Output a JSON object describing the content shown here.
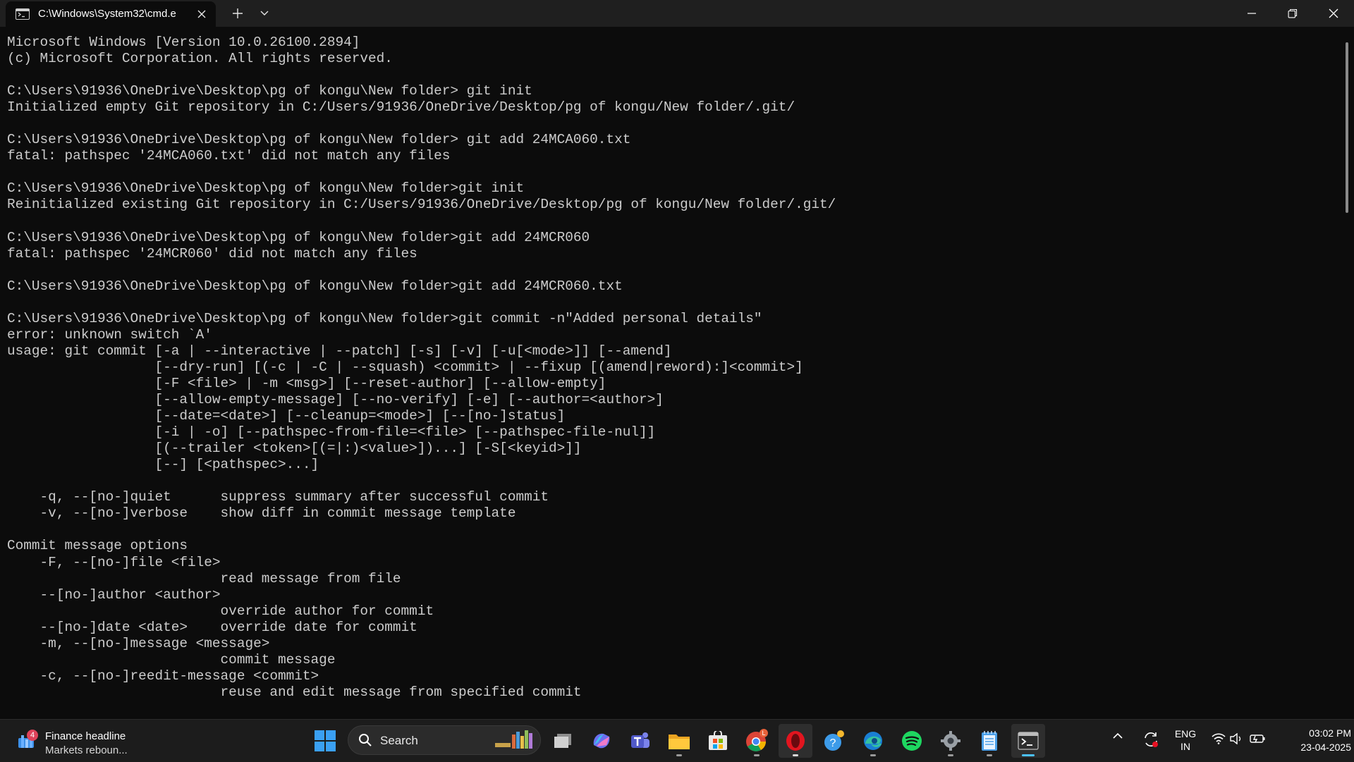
{
  "window": {
    "tab_title": "C:\\Windows\\System32\\cmd.e",
    "icons": {
      "tab": "terminal-icon",
      "close_tab": "close-icon",
      "new_tab": "plus-icon",
      "dropdown": "chevron-down-icon",
      "minimize": "minimize-icon",
      "maximize": "restore-icon",
      "close": "close-icon"
    }
  },
  "console": {
    "lines": [
      "Microsoft Windows [Version 10.0.26100.2894]",
      "(c) Microsoft Corporation. All rights reserved.",
      "",
      "C:\\Users\\91936\\OneDrive\\Desktop\\pg of kongu\\New folder> git init",
      "Initialized empty Git repository in C:/Users/91936/OneDrive/Desktop/pg of kongu/New folder/.git/",
      "",
      "C:\\Users\\91936\\OneDrive\\Desktop\\pg of kongu\\New folder> git add 24MCA060.txt",
      "fatal: pathspec '24MCA060.txt' did not match any files",
      "",
      "C:\\Users\\91936\\OneDrive\\Desktop\\pg of kongu\\New folder>git init",
      "Reinitialized existing Git repository in C:/Users/91936/OneDrive/Desktop/pg of kongu/New folder/.git/",
      "",
      "C:\\Users\\91936\\OneDrive\\Desktop\\pg of kongu\\New folder>git add 24MCR060",
      "fatal: pathspec '24MCR060' did not match any files",
      "",
      "C:\\Users\\91936\\OneDrive\\Desktop\\pg of kongu\\New folder>git add 24MCR060.txt",
      "",
      "C:\\Users\\91936\\OneDrive\\Desktop\\pg of kongu\\New folder>git commit -n\"Added personal details\"",
      "error: unknown switch `A'",
      "usage: git commit [-a | --interactive | --patch] [-s] [-v] [-u[<mode>]] [--amend]",
      "                  [--dry-run] [(-c | -C | --squash) <commit> | --fixup [(amend|reword):]<commit>]",
      "                  [-F <file> | -m <msg>] [--reset-author] [--allow-empty]",
      "                  [--allow-empty-message] [--no-verify] [-e] [--author=<author>]",
      "                  [--date=<date>] [--cleanup=<mode>] [--[no-]status]",
      "                  [-i | -o] [--pathspec-from-file=<file> [--pathspec-file-nul]]",
      "                  [(--trailer <token>[(=|:)<value>])...] [-S[<keyid>]]",
      "                  [--] [<pathspec>...]",
      "",
      "    -q, --[no-]quiet      suppress summary after successful commit",
      "    -v, --[no-]verbose    show diff in commit message template",
      "",
      "Commit message options",
      "    -F, --[no-]file <file>",
      "                          read message from file",
      "    --[no-]author <author>",
      "                          override author for commit",
      "    --[no-]date <date>    override date for commit",
      "    -m, --[no-]message <message>",
      "                          commit message",
      "    -c, --[no-]reedit-message <commit>",
      "                          reuse and edit message from specified commit"
    ]
  },
  "taskbar": {
    "widget": {
      "badge": "4",
      "title": "Finance headline",
      "subtitle": "Markets reboun..."
    },
    "search_placeholder": "Search",
    "apps": [
      {
        "name": "start-button",
        "icon": "windows-logo-icon"
      },
      {
        "name": "task-view",
        "icon": "task-view-icon"
      },
      {
        "name": "copilot",
        "icon": "copilot-icon"
      },
      {
        "name": "teams",
        "icon": "teams-icon"
      },
      {
        "name": "file-explorer",
        "icon": "folder-icon"
      },
      {
        "name": "microsoft-store",
        "icon": "store-icon"
      },
      {
        "name": "chrome",
        "icon": "chrome-icon",
        "badge": "L"
      },
      {
        "name": "opera",
        "icon": "opera-icon"
      },
      {
        "name": "help",
        "icon": "help-icon"
      },
      {
        "name": "edge",
        "icon": "edge-icon"
      },
      {
        "name": "spotify",
        "icon": "spotify-icon"
      },
      {
        "name": "settings",
        "icon": "gear-icon"
      },
      {
        "name": "notepad",
        "icon": "notepad-icon"
      },
      {
        "name": "terminal",
        "icon": "terminal-icon"
      }
    ],
    "tray": {
      "lang_line1": "ENG",
      "lang_line2": "IN",
      "time": "03:02 PM",
      "date": "23-04-2025"
    }
  },
  "colors": {
    "console_bg": "#0c0c0c",
    "console_text": "#cccccc",
    "titlebar_bg": "#1f1f1f",
    "taskbar_bg": "#1c1c1c",
    "accent": "#4cc2ff"
  }
}
